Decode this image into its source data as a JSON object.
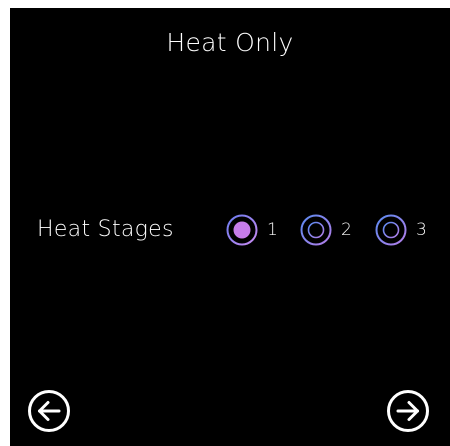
{
  "header": {
    "title": "Heat Only"
  },
  "heat_stages": {
    "label": "Heat Stages",
    "selected": "1",
    "options": [
      {
        "label": "1",
        "selected": true
      },
      {
        "label": "2",
        "selected": false
      },
      {
        "label": "3",
        "selected": false
      }
    ]
  },
  "navigation": {
    "back_icon": "arrow-left-circle-icon",
    "next_icon": "arrow-right-circle-icon"
  },
  "colors": {
    "background": "#000000",
    "text": "#ffffff",
    "radio_gradient_start": "#6a7cf0",
    "radio_gradient_end": "#c98af0",
    "radio_selected_fill": "#c77dea"
  }
}
